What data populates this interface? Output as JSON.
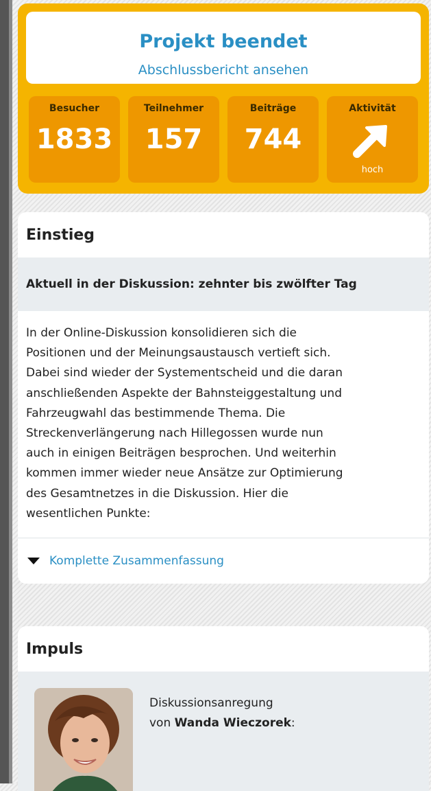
{
  "status": {
    "title": "Projekt beendet",
    "link": "Abschlussbericht ansehen",
    "stats": [
      {
        "label": "Besucher",
        "value": "1833"
      },
      {
        "label": "Teilnehmer",
        "value": "157"
      },
      {
        "label": "Beiträge",
        "value": "744"
      },
      {
        "label": "Aktivität",
        "icon": "arrow-up-right-icon",
        "sub": "hoch"
      }
    ]
  },
  "einstieg": {
    "heading": "Einstieg",
    "subheading": "Aktuell in der Diskussion: zehnter bis zwölfter Tag",
    "lines": [
      "In der Online-Diskussion konsolidieren sich die",
      "Positionen und der Meinungsaustausch vertieft sich.",
      "Dabei sind wieder der Systementscheid und die daran",
      "anschließenden Aspekte der Bahnsteiggestaltung und",
      "Fahrzeugwahl das bestimmende Thema. Die",
      "Streckenverlängerung nach Hillegossen wurde nun",
      "auch in einigen Beiträgen besprochen. Und weiterhin",
      "kommen immer wieder neue Ansätze zur Optimierung",
      "des Gesamtnetzes in die Diskussion. Hier die",
      "wesentlichen Punkte:"
    ],
    "toggle": "Komplette Zusammenfassung"
  },
  "impuls": {
    "heading": "Impuls",
    "line1": "Diskussionsanregung",
    "von": "von",
    "author": "Wanda Wieczorek",
    "colon": ":"
  },
  "colors": {
    "panel": "#f5b400",
    "tile": "#ee9700",
    "link": "#2a8fc4"
  }
}
